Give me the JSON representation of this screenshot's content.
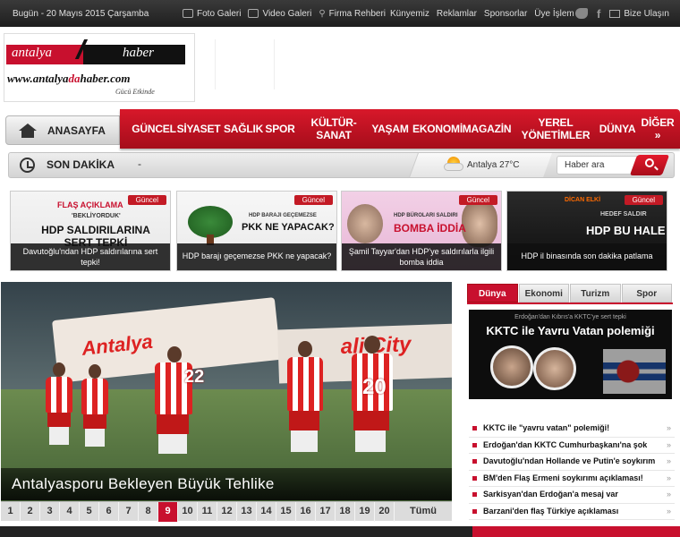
{
  "topbar": {
    "date": "Bugün - 20 Mayıs 2015 Çarşamba",
    "links": [
      "Foto Galeri",
      "Video Galeri",
      "Firma Rehberi"
    ],
    "links2": [
      "Künyemiz",
      "Reklamlar",
      "Sponsorlar",
      "Üye İşlem"
    ],
    "contact": "Bize Ulaşın"
  },
  "logo": {
    "left": "antalya",
    "right": "haber",
    "url_a": "www.antalya",
    "url_b": "da",
    "url_c": "haber.com",
    "slogan": "Gücü Etkinde"
  },
  "nav": {
    "home": "ANASAYFA",
    "items": [
      "GÜNCEL",
      "SİYASET",
      "SAĞLIK",
      "SPOR",
      "KÜLTÜR-SANAT",
      "YAŞAM",
      "EKONOMİ",
      "MAGAZİN",
      "YEREL YÖNETİMLER",
      "DÜNYA",
      "DİĞER »"
    ]
  },
  "son_dakika": {
    "label": "SON DAKİKA",
    "ticker": "-",
    "weather": "Antalya 27°C",
    "search_placeholder": "Haber ara"
  },
  "cards": [
    {
      "tag": "Güncel",
      "head": "HDP SALDIRILARINA SERT TEPKİ",
      "kicker": "FLAŞ AÇIKLAMA",
      "quote": "'BEKLİYORDUK'",
      "caption": "Davutoğlu'ndan HDP saldırılarına sert tepki!"
    },
    {
      "tag": "Güncel",
      "head": "PKK NE YAPACAK?",
      "kicker": "HDP BARAJI GEÇEMEZSE",
      "caption": "HDP barajı geçemezse PKK ne yapacak?"
    },
    {
      "tag": "Güncel",
      "head": "BOMBA İDDİA",
      "kicker": "HDP BÜROLARI SALDIRI",
      "caption": "Şamil Tayyar'dan HDP'ye saldırılarla ilgili bomba iddia"
    },
    {
      "tag": "Güncel",
      "head": "HDP BU HALE",
      "kicker": "DİCAN ELKİ",
      "sub": "HEDEF SALDIR",
      "caption": "HDP il binasında son dakika patlama"
    }
  ],
  "slider": {
    "title": "Antalyasporu Bekleyen Büyük Tehlike",
    "banner_text": "Antalya",
    "banner_text2": "ali City",
    "shirt_numbers": [
      "22",
      "20"
    ],
    "pages": [
      "1",
      "2",
      "3",
      "4",
      "5",
      "6",
      "7",
      "8",
      "9",
      "10",
      "11",
      "12",
      "13",
      "14",
      "15",
      "16",
      "17",
      "18",
      "19",
      "20"
    ],
    "active_page": "9",
    "all_label": "Tümü"
  },
  "widget": {
    "tabs": [
      "Dünya",
      "Ekonomi",
      "Turizm",
      "Spor"
    ],
    "active_tab": "Dünya",
    "image_sub": "Erdoğan'dan Kıbrıs'a KKTC'ye sert tepki",
    "image_headline": "KKTC ile Yavru Vatan polemiği",
    "news": [
      "KKTC ile \"yavru vatan\" polemiği!",
      "Erdoğan'dan KKTC Cumhurbaşkanı'na şok",
      "Davutoğlu'ndan Hollande ve Putin'e soykırım",
      "BM'den Flaş Ermeni soykırımı açıklaması!",
      "Sarkisyan'dan Erdoğan'a mesaj var",
      "Barzani'den flaş Türkiye açıklaması"
    ],
    "chevron": "»"
  },
  "colors": {
    "brand_red": "#c8102e",
    "dark_bar": "#2a2a2a"
  }
}
